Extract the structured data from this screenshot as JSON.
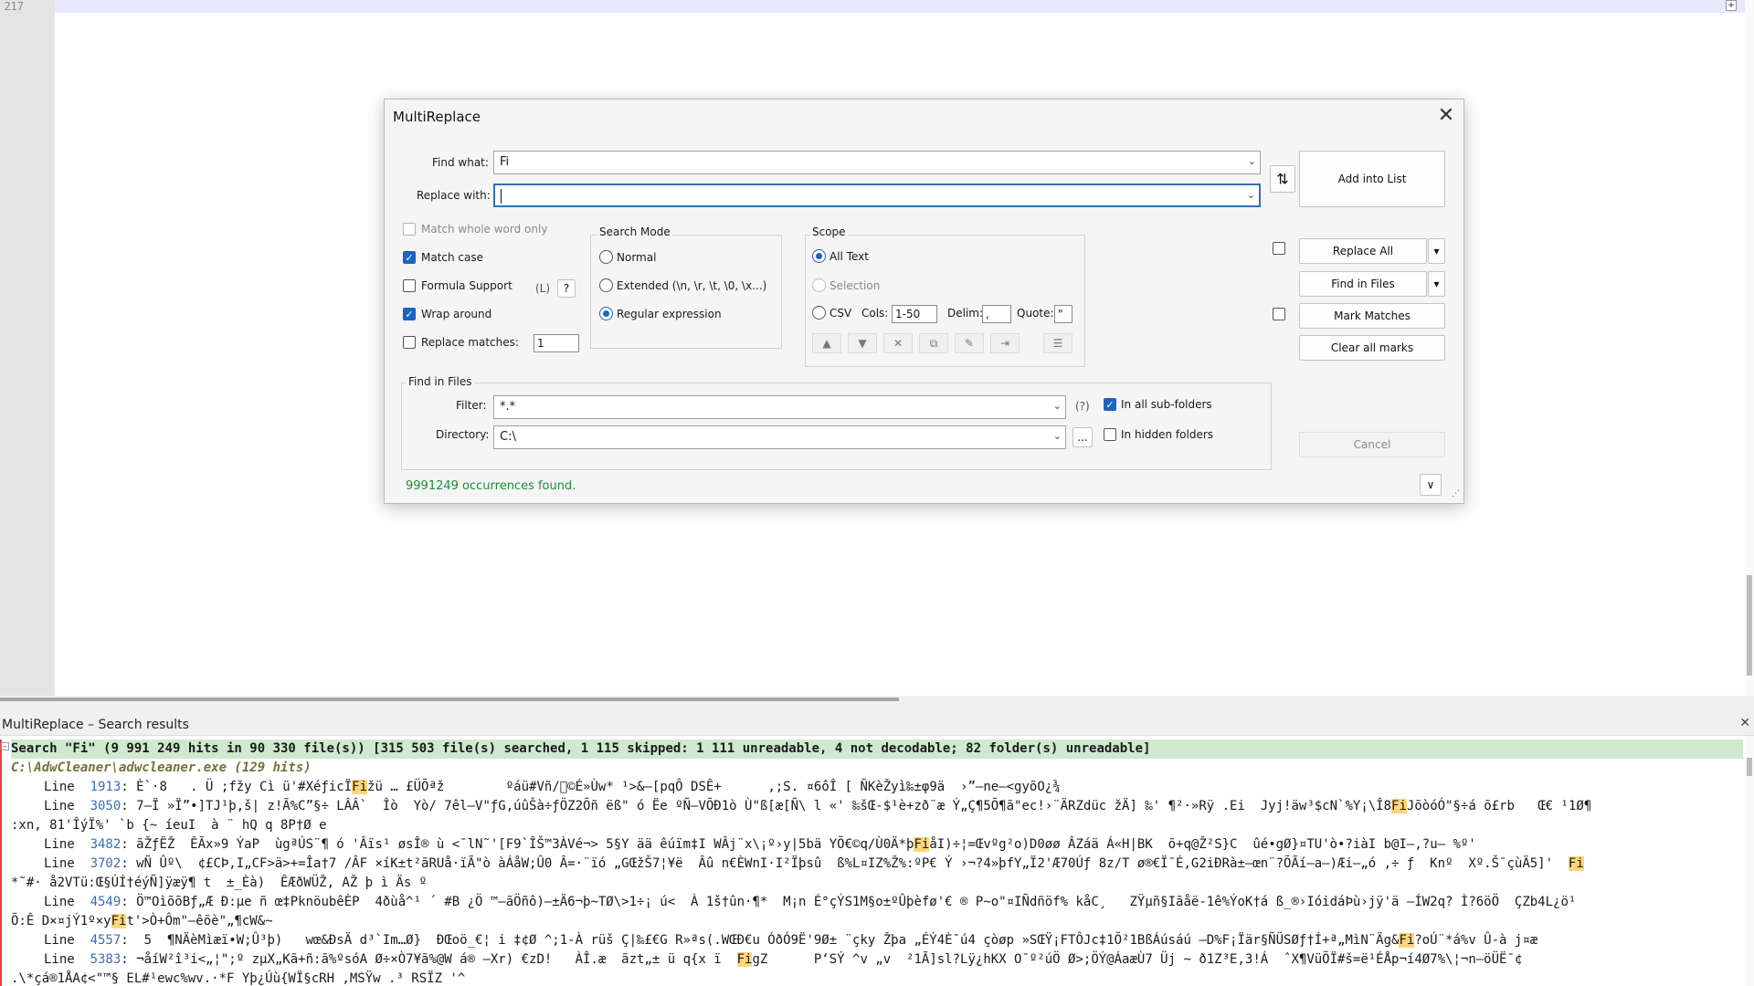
{
  "editor": {
    "line_number": "217",
    "plus_icon": "+"
  },
  "dialog": {
    "title": "MultiReplace",
    "close": "✕",
    "find_label": "Find what:",
    "find_value": "Fi",
    "replace_label": "Replace with:",
    "replace_value": "",
    "swap_icon": "⇅",
    "add_into_list": "Add into List",
    "options": {
      "match_whole_word": "Match whole word only",
      "match_case": "Match case",
      "formula_support": "Formula Support",
      "formula_l": "(L)",
      "formula_help": "?",
      "wrap_around": "Wrap around",
      "replace_matches": "Replace matches:",
      "replace_matches_value": "1"
    },
    "search_mode": {
      "title": "Search Mode",
      "normal": "Normal",
      "extended": "Extended (\\n, \\r, \\t, \\0, \\x...)",
      "regex": "Regular expression"
    },
    "scope": {
      "title": "Scope",
      "all_text": "All Text",
      "selection": "Selection",
      "csv": "CSV",
      "cols_label": "Cols:",
      "cols_value": "1-50",
      "delim_label": "Delim:",
      "delim_value": ",",
      "quote_label": "Quote:",
      "quote_value": "\"",
      "tool_icons": [
        "▲",
        "▼",
        "✕",
        "⧉",
        "✎",
        "⇥",
        "☰"
      ]
    },
    "buttons": {
      "replace_all": "Replace All",
      "find_in_files": "Find in Files",
      "mark_matches": "Mark Matches",
      "clear_all_marks": "Clear all marks",
      "cancel": "Cancel",
      "dropdown": "▾",
      "expand": "∨"
    },
    "find_in_files": {
      "title": "Find in Files",
      "filter_label": "Filter:",
      "filter_value": "*.*",
      "filter_help": "(?)",
      "directory_label": "Directory:",
      "directory_value": "C:\\",
      "browse": "...",
      "in_subfolders": "In all sub-folders",
      "in_hidden": "In hidden folders"
    },
    "status": "9991249 occurrences found."
  },
  "results": {
    "title": "MultiReplace – Search results",
    "close": "✕",
    "summary": "Search \"Fi\" (9 991 249 hits in 90 330 file(s)) [315 503 file(s) searched, 1 115 skipped: 1 111 unreadable, 4 not decodable; 82 folder(s) unreadable]",
    "file": "C:\\AdwCleaner\\adwcleaner.exe (129 hits)",
    "lines": [
      {
        "pre": "Line  ",
        "num": "1913",
        "a": ": È`·8   . Ü ;fžy Cì ü'#XéƒicÏ",
        "hl": "Fi",
        "b": "žü … £ÜÕªž        ºáü#Vñ/\u0000©É»Ùw* ¹>&–[pqÔ DSÊ+      ,;S. ¤6ôÎ [ ÑKèŽyì‰±φ9ä  ›”–ne–<gyõO¿¾"
      },
      {
        "pre": "Line  ",
        "num": "3050",
        "a": ": 7–Ï »Ï”•]TJ¹þ,š| z!Ã%C”§÷ LÂÂ`  Îò  Yò/ 7êl–V\"ƒG,úûŠà÷ƒÖZ2Õñ ëß\" ó Ëe ºÑ–VÕÐ1ò Ù\"ß[æ[Ñ\\ l «' ‰šŒ-$¹è+zð¨æ Ý„Ç¶5Õ¶ã\"ec!›¨ÄRZdüc žÄ] ‰' ¶²·»Rÿ .Ei  Jyj!äw³$cN`%Y¡\\Î8",
        "hl": "Fi",
        "b": "JõòóÓ\"§÷á õ£rb   Œ€ ¹1Ø¶"
      },
      {
        "pre": ":xn, 81'ÎýÏ%' `b {~ íeuI  à ¨ hQ q 8P†Ø e",
        "num": "",
        "a": "",
        "hl": "",
        "b": ""
      },
      {
        "pre": "Line  ",
        "num": "3482",
        "a": ": ãŽƒËŽ  ÊÃx»9 ÝaP  ùgªÚS¨¶ ó 'Âïs¹ øsÎ® ù <¯lN˜'[F9`ÎŠ™3ÀVé¬> 5§Y ää êúïm‡I WÂj¨x\\¡º›y|5bä YÕ€©q/Ù0Ä*þ",
        "hl": "Fi",
        "b": "åI)÷¦=Œvºg²o)D0øø ÂZáä Á«H|BK  õ+q@Ž²S}C  ûé•gØ}¤TU'ò•?iàI b@I–,?u– %º'"
      },
      {
        "pre": "Line  ",
        "num": "3702",
        "a": ": wÑ Ûº\\  ¢£CÞ,I„CF>ä>+=Îa†7 /ÂF ×íK±t²ãRUå·ïÃ\"ò àÁåW;Û0 Â=·¨ïó „GŒžŠ7¦¥ë  Âû n€ÈWnI·I²Ïþsû  ß%L¤IZ%Ž%:ºP€ Ý ›¬?4»þfY„Ï2'Æ70Úƒ 8z/T ø®€Ï¯É,G2iÐRà±–œn¨?ÕÃí–a–)Æi–„ó ,÷ ƒ  Knº  Xº.Š¯çùÄ5]'  ",
        "hl": "Fi",
        "b": ""
      },
      {
        "pre": "*˜#· å2VTü:Œ§ÚÍ†éýÑ]ÿæÿ¶ t  ±_Èà)  ÊÆðWÜŽ, AŽ þ ì Äs º",
        "num": "",
        "a": "",
        "hl": "",
        "b": ""
      },
      {
        "pre": "Line  ",
        "num": "4549",
        "a": ": Ö™OìõõBƒ„Æ Ð:µe ñ œ‡PknöubêÈP  4ðùå^¹ ´ #B ¿Ö ™–ãÖñô)–±Ä6¬þ~TØ\\>1÷¡ ú<  À 1š†ûn·¶*  M¡n É°çÝS1M§o±ºÛþèfø'€ ® P~o\"¤IÑdñöf% kåC¸   ZŸµñ§Iãåë-1ê%ÝoK†á ß_®›IóidáÞù›jÿ'ä –ÍW2q? Ì?6öÖ  ÇZb4L¿ö¹",
        "hl": "",
        "b": ""
      },
      {
        "pre": "Õ:Ê D×¤jÝ1º×y",
        "num": "",
        "a": "",
        "hl": "Fi",
        "b": "t'>Ò+Ôm\"–êõè\"„¶cW&~"
      },
      {
        "pre": "Line  ",
        "num": "4557",
        "a": ":  5  ¶NÄèMìæï•W;Û³þ)   wœ&ÐsÄ d³`Im…Ø}  ÐŒoö_€¦ i ‡¢Ø ^;1-À rüš Ç|‰£€G R»ªs(.WŒÐ€u ÓðÓ9Ë'9Ø± ¨çky Žþa „ÉÝ4È¯ú4 çòøp »SŒŸ¡FTÔJc‡1Õ²1BßÁúsáú –D%F¡Ïär§ÑÜSØƒ†Í+ª„MìN¨Äg&",
        "hl": "Fi",
        "b": "?oÚ¨*á%v Û-à j¤æ"
      },
      {
        "pre": "Line  ",
        "num": "5383",
        "a": ": ¬åíW²î³i<„¦\";º zµX„Kã+ñ:ã%ºsóA Ø÷×Ò7¥ã%@W á® –Xr) €zD!   ÀÎ.æ  ãzt„± ü q{x ï  ",
        "hl": "Fi",
        "b": "gZ      P‘SÝ ^v „v  ²1Ã]sl?Lÿ¿hKX O¯º²úÖ Ø>;ÖÝ@ÁaæÙ7 Üj ~ ð1Z³E,3!Á  ˆX¶VüÕÏ#š=ë¹ÉÅp¬í4Ø7%\\¦¬n–öÜË¯¢"
      },
      {
        "pre": ".\\*çá®1ÅA¢<\"™§ EL#¹ewc%wv.·*F Yþ¿Úù{WÏ§cRH ,MSŸw .³ RSÏZ '^",
        "num": "",
        "a": "",
        "hl": "",
        "b": ""
      }
    ]
  }
}
